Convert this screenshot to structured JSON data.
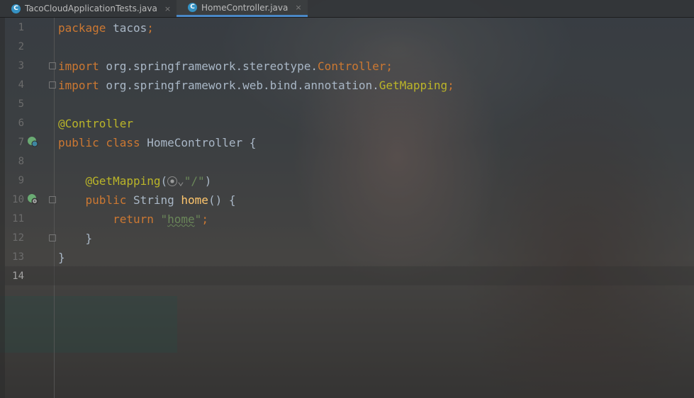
{
  "tabs": [
    {
      "label": "TacoCloudApplicationTests.java",
      "icon": "java-class-icon",
      "active": false
    },
    {
      "label": "HomeController.java",
      "icon": "java-class-icon",
      "active": true
    }
  ],
  "tab_icon_letter": "C",
  "tab_close_glyph": "×",
  "line_numbers": [
    "1",
    "2",
    "3",
    "4",
    "5",
    "6",
    "7",
    "8",
    "9",
    "10",
    "11",
    "12",
    "13",
    "14"
  ],
  "current_line": "14",
  "code": {
    "l1": {
      "kw": "package",
      "text": " tacos",
      "punct": ";"
    },
    "l3": {
      "kw": "import",
      "pkg": " org.springframework.stereotype.",
      "cls": "Controller",
      "punct": ";"
    },
    "l4": {
      "kw": "import",
      "pkg": " org.springframework.web.bind.annotation.",
      "cls": "GetMapping",
      "punct": ";"
    },
    "l6": {
      "ann": "@Controller"
    },
    "l7": {
      "kw1": "public",
      "kw2": " class",
      "name": " HomeController",
      "brace": " {"
    },
    "l9": {
      "indent": "    ",
      "ann": "@GetMapping",
      "open": "(",
      "chevron": "⌄",
      "str": "\"/\"",
      "close": ")"
    },
    "l10": {
      "indent": "    ",
      "kw": "public",
      "type": " String",
      "fn": " home",
      "rest": "() {"
    },
    "l11": {
      "indent": "        ",
      "kw": "return",
      "sp": " ",
      "str_open": "\"",
      "str": "home",
      "str_close": "\"",
      "punct": ";"
    },
    "l12": {
      "indent": "    ",
      "brace": "}"
    },
    "l13": {
      "brace": "}"
    }
  },
  "colors": {
    "keyword": "#cc7832",
    "annotation": "#bbb529",
    "string": "#6a8759",
    "function": "#ffc66d",
    "plain": "#a9b7c6",
    "line_number": "#6c6c6c",
    "tab_accent": "#4a88c7"
  },
  "gutter_icons": [
    {
      "line": "7",
      "icon": "spring-bean-icon"
    },
    {
      "line": "10",
      "icon": "spring-web-endpoint-icon"
    }
  ]
}
